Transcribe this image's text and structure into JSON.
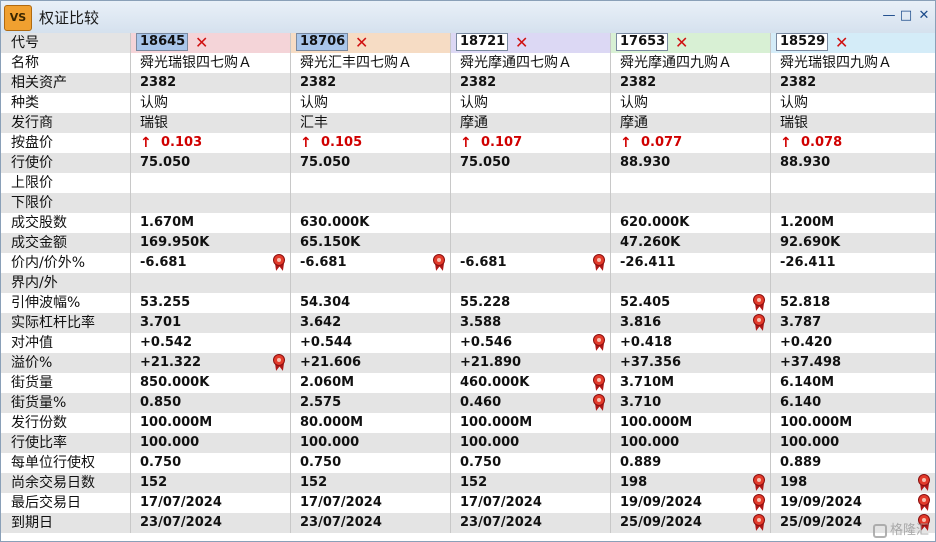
{
  "window": {
    "title": "权证比较",
    "icon_label": "VS"
  },
  "codes": [
    "18645",
    "18706",
    "18721",
    "17653",
    "18529"
  ],
  "code_colors": [
    "#f4d4d8",
    "#f6dcc4",
    "#dcd8f4",
    "#d8f0d4",
    "#d4ecf8"
  ],
  "labels": [
    "代号",
    "名称",
    "相关资产",
    "种类",
    "发行商",
    "按盘价",
    "行使价",
    "上限价",
    "下限价",
    "成交股数",
    "成交金额",
    "价内/价外%",
    "界内/外",
    "引伸波幅%",
    "实际杠杆比率",
    "对冲值",
    "溢价%",
    "街货量",
    "街货量%",
    "发行份数",
    "行使比率",
    "每单位行使权",
    "尚余交易日数",
    "最后交易日",
    "到期日"
  ],
  "rows": [
    [
      "舜光瑞银四七购Ａ",
      "舜光汇丰四七购Ａ",
      "舜光摩通四七购Ａ",
      "舜光摩通四九购Ａ",
      "舜光瑞银四九购Ａ"
    ],
    [
      "2382",
      "2382",
      "2382",
      "2382",
      "2382"
    ],
    [
      "认购",
      "认购",
      "认购",
      "认购",
      "认购"
    ],
    [
      "瑞银",
      "汇丰",
      "摩通",
      "摩通",
      "瑞银"
    ],
    [
      "0.103",
      "0.105",
      "0.107",
      "0.077",
      "0.078"
    ],
    [
      "75.050",
      "75.050",
      "75.050",
      "88.930",
      "88.930"
    ],
    [
      "",
      "",
      "",
      "",
      ""
    ],
    [
      "",
      "",
      "",
      "",
      ""
    ],
    [
      "1.670M",
      "630.000K",
      "",
      "620.000K",
      "1.200M"
    ],
    [
      "169.950K",
      "65.150K",
      "",
      "47.260K",
      "92.690K"
    ],
    [
      "-6.681",
      "-6.681",
      "-6.681",
      "-26.411",
      "-26.411"
    ],
    [
      "",
      "",
      "",
      "",
      ""
    ],
    [
      "53.255",
      "54.304",
      "55.228",
      "52.405",
      "52.818"
    ],
    [
      "3.701",
      "3.642",
      "3.588",
      "3.816",
      "3.787"
    ],
    [
      "+0.542",
      "+0.544",
      "+0.546",
      "+0.418",
      "+0.420"
    ],
    [
      "+21.322",
      "+21.606",
      "+21.890",
      "+37.356",
      "+37.498"
    ],
    [
      "850.000K",
      "2.060M",
      "460.000K",
      "3.710M",
      "6.140M"
    ],
    [
      "0.850",
      "2.575",
      "0.460",
      "3.710",
      "6.140"
    ],
    [
      "100.000M",
      "80.000M",
      "100.000M",
      "100.000M",
      "100.000M"
    ],
    [
      "100.000",
      "100.000",
      "100.000",
      "100.000",
      "100.000"
    ],
    [
      "0.750",
      "0.750",
      "0.750",
      "0.889",
      "0.889"
    ],
    [
      "152",
      "152",
      "152",
      "198",
      "198"
    ],
    [
      "17/07/2024",
      "17/07/2024",
      "17/07/2024",
      "19/09/2024",
      "19/09/2024"
    ],
    [
      "23/07/2024",
      "23/07/2024",
      "23/07/2024",
      "25/09/2024",
      "25/09/2024"
    ]
  ],
  "medals": {
    "11": [
      0,
      1,
      2
    ],
    "13": [
      3
    ],
    "14": [
      3
    ],
    "15": [
      2
    ],
    "16": [
      0
    ],
    "17": [
      2
    ],
    "18": [
      2
    ],
    "22": [
      3,
      4
    ],
    "23": [
      3,
      4
    ],
    "24": [
      3,
      4
    ]
  },
  "watermark": "格隆汇",
  "icons": {
    "remove": "close-x-icon",
    "price_up": "up-arrow-icon",
    "award": "ribbon-medal-icon"
  },
  "colors": {
    "price_text": "#d00000",
    "remove_x": "#d01010",
    "alt_row": "#e4e4e4"
  }
}
